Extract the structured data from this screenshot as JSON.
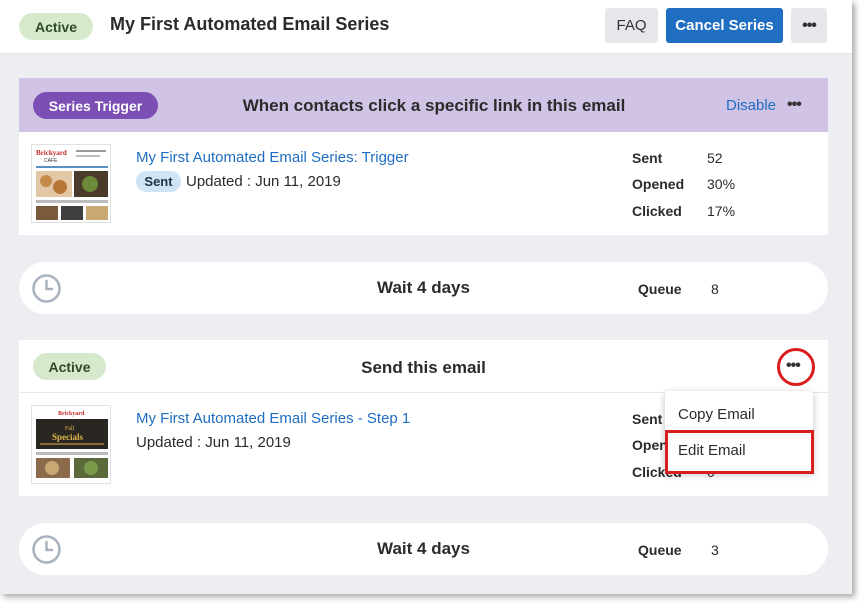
{
  "header": {
    "status": "Active",
    "title": "My First Automated Email Series",
    "faq_label": "FAQ",
    "cancel_label": "Cancel Series",
    "more_label": "•••"
  },
  "trigger": {
    "badge": "Series Trigger",
    "title": "When contacts click a specific link in this email",
    "disable_label": "Disable",
    "more_label": "•••",
    "email_name": "My First Automated Email Series: Trigger",
    "status": "Sent",
    "updated": "Updated : Jun 11, 2019",
    "stats": [
      {
        "label": "Sent",
        "value": "52"
      },
      {
        "label": "Opened",
        "value": "30%"
      },
      {
        "label": "Clicked",
        "value": "17%"
      }
    ]
  },
  "wait1": {
    "label": "Wait 4 days",
    "queue_label": "Queue",
    "queue_value": "8"
  },
  "step1": {
    "status": "Active",
    "title": "Send this email",
    "more_label": "•••",
    "email_name": "My First Automated Email Series - Step 1",
    "updated": "Updated : Jun 11, 2019",
    "stats": [
      {
        "label": "Sent",
        "value": ""
      },
      {
        "label": "Opened",
        "value": ""
      },
      {
        "label": "Clicked",
        "value": "0"
      }
    ]
  },
  "menu": {
    "items": [
      "Copy Email",
      "Edit Email"
    ]
  },
  "wait2": {
    "label": "Wait 4 days",
    "queue_label": "Queue",
    "queue_value": "3"
  },
  "thumbs": {
    "brand_line1": "Brickyard",
    "brand_line2": "CAFE",
    "special_line1": "Fall",
    "special_line2": "Specials"
  },
  "colors": {
    "accent_blue": "#1f6ec1",
    "trigger_purple": "#7b4fb3",
    "trigger_bar": "#d0c3e6",
    "active_green": "#d7e9cd",
    "highlight_red": "#d81e1e"
  },
  "icons": {
    "clock": "clock-icon",
    "more": "more-dots-icon"
  }
}
